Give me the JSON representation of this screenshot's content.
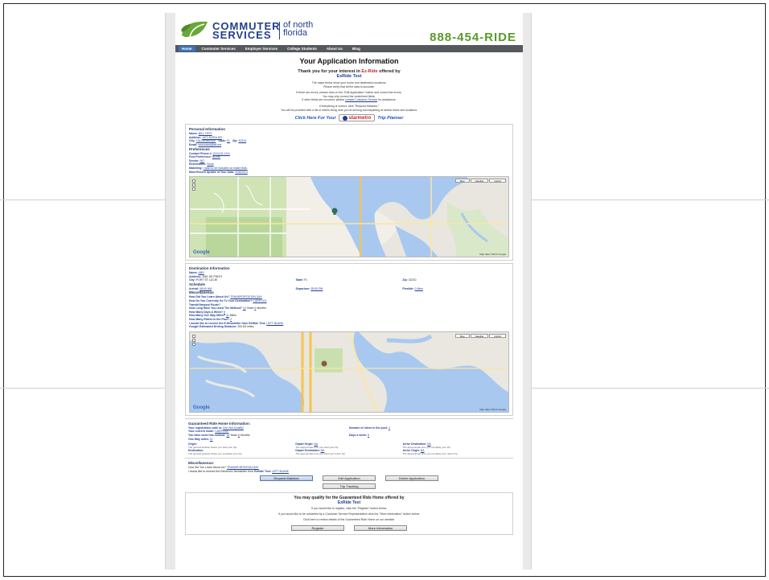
{
  "header": {
    "brand_line1": "COMMUTER",
    "brand_line2": "SERVICES",
    "brand_of": "of north",
    "brand_region": "florida",
    "phone": "888-454-RIDE",
    "leaf_color": "#6aa73a",
    "brand_color": "#22408a"
  },
  "nav": {
    "items": [
      "Home",
      "Commuter Services",
      "Employer Services",
      "College Students",
      "About Us",
      "Blog"
    ]
  },
  "page_title": "Your Application Information",
  "thanks": {
    "prefix": "Thank you for your interest in",
    "program": "Ez-Ride",
    "suffix": "offered by",
    "org": "ExRide Test"
  },
  "intro": {
    "line1": "The maps below show your home and destination locations.",
    "line2": "Please verify that all the data is accurate.",
    "line3": "If there are errors, please click on the \"Edit Application\" button and correct the errors.",
    "line4": "You may only correct the underlined fields.",
    "line5_prefix": "If other fields are incorrect, please",
    "line5_link": "contact Customer Service",
    "line5_suffix": "for assistance.",
    "line6": "If everything is correct, click \"Request Matches.\"",
    "line7": "You will be provided with a list of others living near you at arriving and departing at similar times and locations."
  },
  "planner": {
    "prefix": "Click Here For Your",
    "logo": "starmetro",
    "suffix": "Trip Planner"
  },
  "personal": {
    "heading": "Personal Information",
    "name_label": "Name:",
    "name": "BILL TEST",
    "address_label": "Address:",
    "address": "1471 NORA DR",
    "city_label": "City:",
    "city": "TALLAHASSEE",
    "state_label": "State:",
    "state": "FL",
    "zip_label": "Zip:",
    "zip": "32310",
    "email_label": "Email:",
    "email": "wrnustard@att.net",
    "pref_heading": "Preferences",
    "phone_label": "Contact Phone #:",
    "phone": "(111)111-1111",
    "pool_label": "Pool Preference:",
    "pool": "NONE",
    "smoke_label": "Smoke:",
    "smoke": "NO",
    "restrict_label": "Restrictions:",
    "restrict": "None",
    "matching_label": "Matching:",
    "matching": "I wish to be included on match lists.",
    "update_label": "Most Recent Update of Your Data:",
    "update": "3/28/2013"
  },
  "map_controls": {
    "map": "Map",
    "satellite": "Satellite",
    "hybrid": "Hybrid",
    "google": "Google",
    "scale": "1000 ft",
    "attribution": "Map data ©2013 Google"
  },
  "destination": {
    "heading": "Destination Information",
    "name_label": "Name:",
    "name": "ABO",
    "address_label": "Address:",
    "address": "1061 SE PINTO",
    "city_label": "City:",
    "city": "PORT ST LUCIE",
    "state_label": "State:",
    "state": "FL",
    "zip_label": "Zip:",
    "zip": "32210",
    "sched_heading": "Schedule",
    "arrival_label": "Arrival:",
    "arrival": "08:00 AM",
    "departure_label": "Departure:",
    "departure": "05:00 PM",
    "flex_label": "Flexible:",
    "flex": "0 Mins",
    "misc_heading": "Miscellaneous",
    "q1_label": "How Did You Learn About Us?",
    "q1": "TRANSPORTATION DAY",
    "q2_label": "How Do You Currently Go To Your Destination?",
    "q2": "CARPOOL",
    "q3_label": "Transit/Vanpool Route?",
    "q4_label": "How Long Have You Used The Method?",
    "q4a": "16",
    "q4a_unit": "Years",
    "q4b": "6",
    "q4b_unit": "Months",
    "q5_label": "How Many Days A Week?",
    "q5": "5",
    "q6_label": "How Many One Way Miles?",
    "q6": "11",
    "q6_unit": "Miles",
    "q7_label": "How Many Riders in the Pool?",
    "q7": "2",
    "q8_label": "I would like to receive the E-Newsletter from",
    "q8_org": "ExRide Test:",
    "q8": "LEFT BLANK",
    "q9_label": "Google Estimated Driving Distance:",
    "q9": "391.83 miles."
  },
  "grh": {
    "heading": "Guaranteed Ride Home Information:",
    "regcode_label": "Your registration code is:",
    "regcode": "Doo Not Qualify!",
    "riders_label": "Number of riders in the pool:",
    "riders": "2",
    "mode_label": "Your current mode:",
    "mode": "CARPOOL",
    "used_label": "You have used this method:",
    "used_years": "16",
    "used_years_unit": "Years",
    "used_months": "6",
    "used_months_unit": "Months",
    "days_label": "Days a week:",
    "days": "5",
    "oneway_label": "One Way miles:",
    "oneway": "11",
    "origin_label": "Origin:",
    "origin_note": "The general location where you start your trip.",
    "depart_origin_label": "Depart Origin:",
    "depart_origin": "NA",
    "depart_origin_note": "The approximate time you start your trip.",
    "arrive_dest_label": "Arrive Destination:",
    "arrive_dest": "NA",
    "arrive_dest_note": "The approximate time you complete your trip.",
    "dest_label": "Destination:",
    "dest_note": "The general location where you complete your trip.",
    "depart_dest_label": "Depart Destination:",
    "depart_dest": "NA",
    "depart_dest_note": "The approximate time you start your return trip.",
    "arrive_origin_label": "Arrive Origin:",
    "arrive_origin": "NA",
    "arrive_origin_note": "The approximate time you complete your return trip."
  },
  "misc2": {
    "heading": "Miscellaneous:",
    "q1_label": "How Did You Learn About Us?",
    "q1": "TRANSPORTATION DAY",
    "q2_label": "I would like to receive the Electronic Newsletter from",
    "q2_org": "ExRide Test:",
    "q2": "LEFT BLANK"
  },
  "buttons": {
    "request": "Request Matches",
    "edit": "Edit Application",
    "delete": "Delete Application",
    "trip": "Trip Tracking",
    "register": "Register",
    "more": "More Information"
  },
  "qualify": {
    "heading": "You may qualify for the Guaranteed Ride Home offered by",
    "org": "ExRide Test",
    "line1": "If you would like to register, click the \"Register\" button below.",
    "line2": "If you would like to be contacted by a Customer Service Representative click the \"More Information\" button below.",
    "line3": "Click here to review details of the Guaranteed Ride Home on our website."
  }
}
